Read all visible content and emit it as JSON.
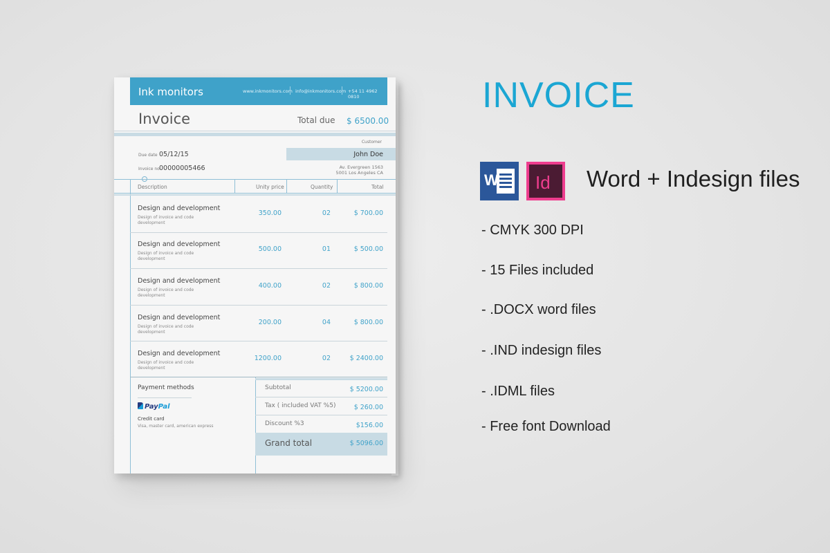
{
  "invoice": {
    "brand": "Ink monitors",
    "contacts": [
      "www.inkmonitors.com",
      "info@inkmonitors.com",
      "+54 11 4962 0810"
    ],
    "title": "Invoice",
    "total_due_label": "Total due",
    "total_due_value": "$ 6500.00",
    "due_date_label": "Due date",
    "due_date_value": "05/12/15",
    "invoice_no_label": "Invoice no",
    "invoice_no_value": "00000005466",
    "customer_label": "Customer",
    "customer_name": "John Doe",
    "address_line1": "Av. Evergreen 1563",
    "address_line2": "5001 Los Angeles CA",
    "columns": [
      "Description",
      "Unity price",
      "Quantity",
      "Total"
    ],
    "items": [
      {
        "desc": "Design and development",
        "sub": "Design of invoice and code development",
        "price": "350.00",
        "qty": "02",
        "total": "$ 700.00"
      },
      {
        "desc": "Design and development",
        "sub": "Design of invoice and code development",
        "price": "500.00",
        "qty": "01",
        "total": "$ 500.00"
      },
      {
        "desc": "Design and development",
        "sub": "Design of invoice and code development",
        "price": "400.00",
        "qty": "02",
        "total": "$ 800.00"
      },
      {
        "desc": "Design and development",
        "sub": "Design of invoice and code development",
        "price": "200.00",
        "qty": "04",
        "total": "$ 800.00"
      },
      {
        "desc": "Design and development",
        "sub": "Design of invoice and code development",
        "price": "1200.00",
        "qty": "02",
        "total": "$ 2400.00"
      }
    ],
    "payment_title": "Payment methods",
    "paypal_a": "Pay",
    "paypal_b": "Pal",
    "card_title": "Credit card",
    "card_sub": "Visa, master card, american express",
    "subtotal_label": "Subtotal",
    "subtotal_value": "$ 5200.00",
    "tax_label": "Tax ( included VAT %5)",
    "tax_value": "$ 260.00",
    "discount_label": "Discount %3",
    "discount_value": "$156.00",
    "grand_label": "Grand total",
    "grand_value": "$ 5096.00"
  },
  "promo": {
    "title": "INVOICE",
    "word_letter": "W",
    "id_letters": "Id",
    "formats": "Word + Indesign files",
    "features": [
      "- CMYK 300 DPI",
      "- 15 Files included",
      "- .DOCX word files",
      "- .IND indesign files",
      "- .IDML files",
      "- Free font Download"
    ]
  },
  "colors": {
    "accent": "#3fa2c9",
    "band": "#c8dbe4",
    "promo_title": "#1ba6d3",
    "word": "#2b579a",
    "indesign": "#ee3d8e"
  }
}
